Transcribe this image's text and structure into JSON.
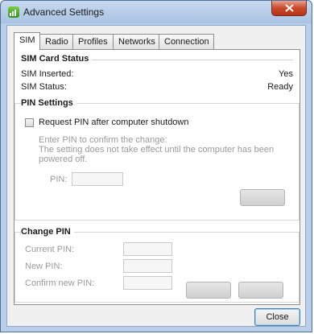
{
  "window": {
    "title": "Advanced Settings",
    "close_icon": "close-x-icon"
  },
  "tabs": [
    {
      "label": "SIM",
      "active": true
    },
    {
      "label": "Radio",
      "active": false
    },
    {
      "label": "Profiles",
      "active": false
    },
    {
      "label": "Networks",
      "active": false
    },
    {
      "label": "Connection",
      "active": false
    }
  ],
  "sim_status": {
    "title": "SIM Card Status",
    "rows": [
      {
        "label": "SIM Inserted:",
        "value": "Yes"
      },
      {
        "label": "SIM Status:",
        "value": "Ready"
      }
    ]
  },
  "pin_settings": {
    "title": "PIN Settings",
    "checkbox_label": "Request PIN after computer shutdown",
    "checked": false,
    "info_line1": "Enter PIN to confirm the change:",
    "info_line2": "The setting does not take effect until the computer has been",
    "info_line3": "powered off.",
    "pin_label": "PIN:",
    "pin_value": "",
    "apply_button": ""
  },
  "change_pin": {
    "title": "Change PIN",
    "current_label": "Current PIN:",
    "new_label": "New PIN:",
    "confirm_label": "Confirm new PIN:",
    "current_value": "",
    "new_value": "",
    "confirm_value": "",
    "button1": "",
    "button2": ""
  },
  "footer": {
    "close_label": "Close"
  }
}
